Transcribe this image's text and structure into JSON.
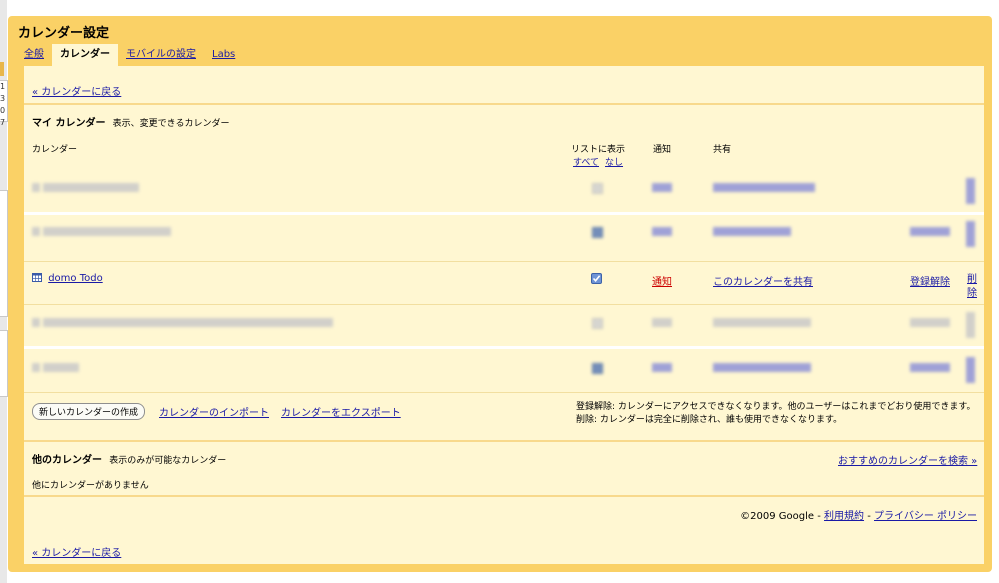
{
  "page": {
    "title": "カレンダー設定"
  },
  "tabs": [
    {
      "label": "全般"
    },
    {
      "label": "カレンダー"
    },
    {
      "label": "モバイルの設定"
    },
    {
      "label": "Labs"
    }
  ],
  "back_link": "« カレンダーに戻る",
  "my_calendars": {
    "heading": "マイ カレンダー",
    "subheading": "表示、変更できるカレンダー",
    "columns": {
      "calendar": "カレンダー",
      "show_in_list": "リストに表示",
      "all": "すべて",
      "none": "なし",
      "notify": "通知",
      "share": "共有"
    },
    "visible_row": {
      "name": "domo Todo",
      "checked": true,
      "notify": "通知",
      "share": "このカレンダーを共有",
      "unsubscribe": "登録解除",
      "delete": "削除",
      "delete_line1": "削",
      "delete_line2": "除"
    }
  },
  "actions": {
    "create": "新しいカレンダーの作成",
    "import": "カレンダーのインポート",
    "export": "カレンダーをエクスポート"
  },
  "notes": {
    "line1": "登録解除: カレンダーにアクセスできなくなります。他のユーザーはこれまでどおり使用できます。",
    "line2": "削除: カレンダーは完全に削除され、誰も使用できなくなります。"
  },
  "other_calendars": {
    "heading": "他のカレンダー",
    "subheading": "表示のみが可能なカレンダー",
    "search_link": "おすすめのカレンダーを検索 »",
    "empty": "他にカレンダーがありません"
  },
  "footer": {
    "copyright": "©2009 Google",
    "sep": "-",
    "terms": "利用規約",
    "privacy": "プライバシー ポリシー"
  },
  "colors": {
    "frame": "#fad166",
    "panel": "#fff7d2",
    "link": "#1a1aa6",
    "alert_link": "#cc0000"
  },
  "left_strip_digits": [
    "1",
    "3",
    "0",
    "7"
  ]
}
